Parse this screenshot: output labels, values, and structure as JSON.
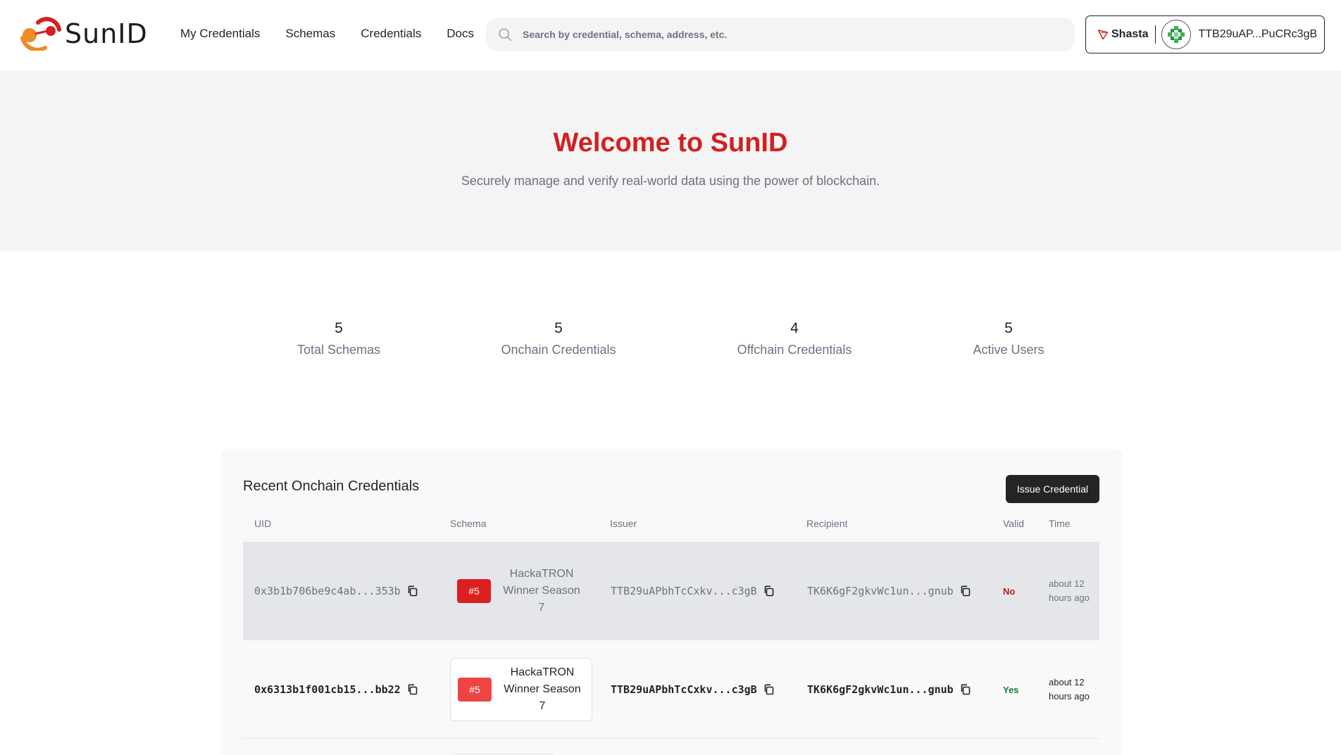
{
  "brand": {
    "name": "SunID",
    "accent": "#d32020"
  },
  "nav": {
    "items": [
      {
        "label": "My Credentials"
      },
      {
        "label": "Schemas"
      },
      {
        "label": "Credentials"
      },
      {
        "label": "Docs"
      }
    ]
  },
  "search": {
    "placeholder": "Search by credential, schema, address, etc.",
    "value": ""
  },
  "wallet": {
    "network": "Shasta",
    "address": "TTB29uAP...PuCRc3gB"
  },
  "hero": {
    "title": "Welcome to SunID",
    "subtitle": "Securely manage and verify real-world data using the power of blockchain."
  },
  "stats": [
    {
      "value": "5",
      "label": "Total Schemas"
    },
    {
      "value": "5",
      "label": "Onchain Credentials"
    },
    {
      "value": "4",
      "label": "Offchain Credentials"
    },
    {
      "value": "5",
      "label": "Active Users"
    }
  ],
  "recent": {
    "title": "Recent Onchain Credentials",
    "issue_button": "Issue Credential",
    "columns": [
      "UID",
      "Schema",
      "Issuer",
      "Recipient",
      "Valid",
      "Time"
    ],
    "rows": [
      {
        "uid": "0x3b1b706be9c4ab...353b",
        "schema_id": "#5",
        "schema_name": "HackaTRON Winner Season 7",
        "issuer": "TTB29uAPbhTcCxkv...c3gB",
        "recipient": "TK6K6gF2gkvWc1un...gnub",
        "valid": "No",
        "time": "about 12 hours ago"
      },
      {
        "uid": "0x6313b1f001cb15...bb22",
        "schema_id": "#5",
        "schema_name": "HackaTRON Winner Season 7",
        "issuer": "TTB29uAPbhTcCxkv...c3gB",
        "recipient": "TK6K6gF2gkvWc1un...gnub",
        "valid": "Yes",
        "time": "about 12 hours ago"
      }
    ]
  },
  "icons": {
    "search": "search-icon",
    "network": "tron-icon",
    "avatar": "identicon-avatar",
    "copy": "copy-icon"
  }
}
